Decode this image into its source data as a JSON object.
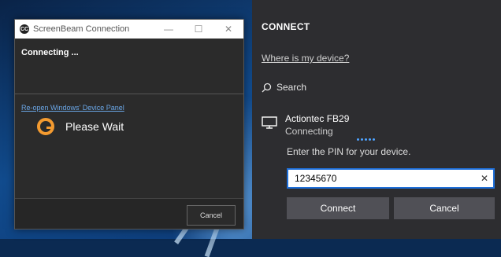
{
  "screenbeam": {
    "title": "ScreenBeam Connection",
    "logo_text": "CC",
    "status": "Connecting ...",
    "reopen_link": "Re-open Windows' Device Panel",
    "wait_label": "Please Wait",
    "cancel_label": "Cancel",
    "controls": {
      "minimize": "—",
      "maximize": "☐",
      "close": "✕"
    },
    "spinner_color": "#f49b30"
  },
  "connect_pane": {
    "title": "CONNECT",
    "where_link": "Where is my device?",
    "search_label": "Search",
    "device": {
      "name": "Actiontec FB29",
      "status": "Connecting"
    },
    "pin_prompt": "Enter the PIN for your device.",
    "pin_value": "12345670",
    "clear_icon": "✕",
    "connect_label": "Connect",
    "cancel_label": "Cancel",
    "accent_color": "#1e6fd9"
  }
}
